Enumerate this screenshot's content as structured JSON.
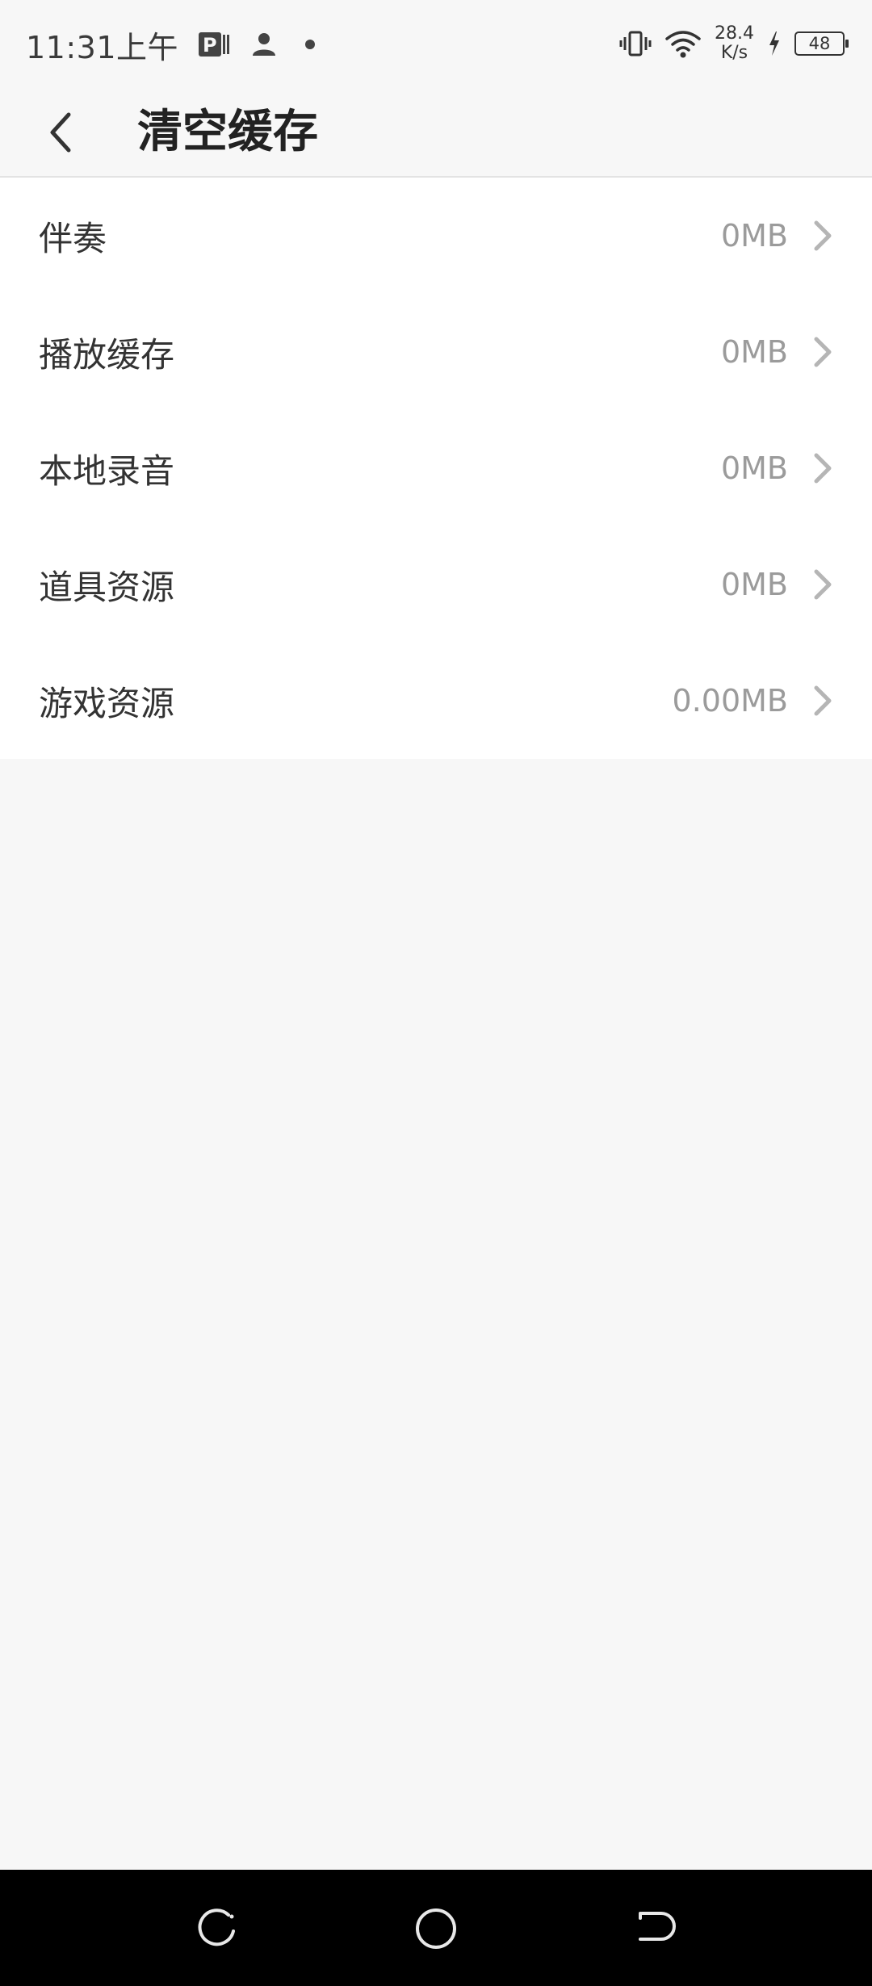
{
  "status_bar": {
    "time": "11:31上午",
    "net_speed_value": "28.4",
    "net_speed_unit": "K/s",
    "battery": "48",
    "icons": [
      "parking-app-icon",
      "person-icon",
      "dot-icon",
      "vibrate-icon",
      "wifi-icon",
      "charging-icon",
      "battery-icon"
    ]
  },
  "header": {
    "title": "清空缓存",
    "back_icon": "chevron-left-icon"
  },
  "cache_items": [
    {
      "label": "伴奏",
      "size": "0MB"
    },
    {
      "label": "播放缓存",
      "size": "0MB"
    },
    {
      "label": "本地录音",
      "size": "0MB"
    },
    {
      "label": "道具资源",
      "size": "0MB"
    },
    {
      "label": "游戏资源",
      "size": "0.00MB"
    }
  ],
  "nav_bar": {
    "icons": [
      "recent-apps-icon",
      "home-icon",
      "back-nav-icon"
    ]
  },
  "colors": {
    "background": "#f7f7f7",
    "list_background": "#ffffff",
    "label_text": "#333333",
    "value_text": "#9b9b9b",
    "chevron": "#b5b5b5",
    "nav_bar": "#000000"
  }
}
